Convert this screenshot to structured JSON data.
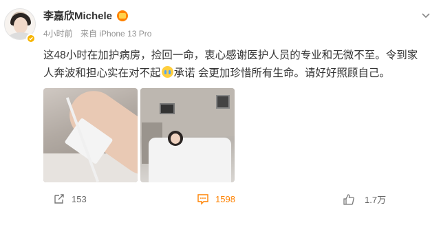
{
  "post": {
    "username": "李嘉欣Michele",
    "time": "4小时前",
    "source": "来自 iPhone 13 Pro",
    "text_before_emoji": "这48小时在加护病房，捡回一命，衷心感谢医护人员的专业和无微不至。令到家人奔波和担心实在对不起",
    "emoji": "crying-face",
    "text_after_emoji": "承诺 会更加珍惜所有生命。请好好照顾自己。"
  },
  "photos": [
    {
      "description_icon": "hospital-arm-iv"
    },
    {
      "description_icon": "hospital-bed"
    }
  ],
  "actions": {
    "repost_count": "153",
    "comment_count": "1598",
    "like_count": "1.7万"
  },
  "colors": {
    "accent": "#ff8200",
    "text": "#333333",
    "meta": "#939393",
    "verified": "#f7b500"
  }
}
